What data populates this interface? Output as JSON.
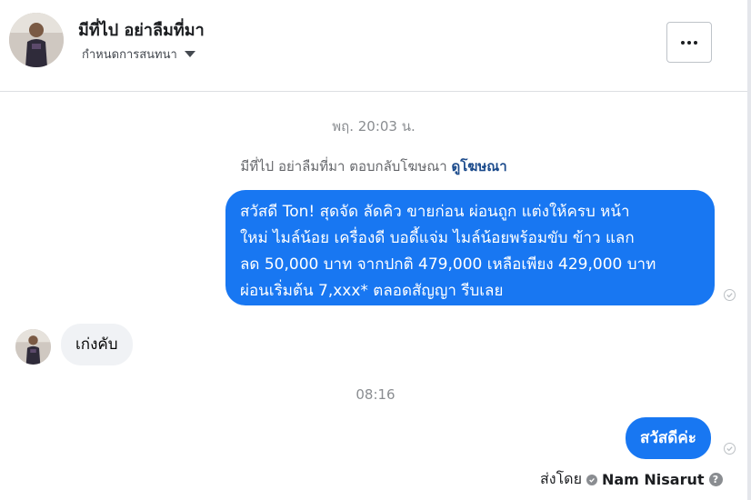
{
  "header": {
    "title": "มีที่ไป อย่าลืมที่มา",
    "subtitle": "กำหนดการสนทนา",
    "more_label": "..."
  },
  "messages": {
    "timestamp_1": "พฤ. 20:03 น.",
    "notice_text": "มีที่ไป อย่าลืมที่มา ตอบกลับโฆษณา",
    "notice_link": "ดูโฆษณา",
    "outgoing_1_lines": [
      "สวัสดี Ton!  สุดจัด ลัดคิว ขายก่อน ผ่อนถูก แต่งให้ครบ หน้า",
      "ใหม่ ไมล์น้อย เครื่องดี บอดี้แจ่ม ไมล์น้อยพร้อมขับ ข้าว แลก",
      "ลด 50,000 บาท จากปกติ 479,000 เหลือเพียง 429,000 บาท",
      "ผ่อนเริ่มต้น 7,xxx* ตลอดสัญญา รีบเลย"
    ],
    "incoming_1": "เก่งคับ",
    "timestamp_2": "08:16",
    "outgoing_2": "สวัสดีค่ะ"
  },
  "footer": {
    "sent_by_label": "ส่งโดย",
    "sender_name": "Nam Nisarut",
    "help_icon": "?"
  },
  "colors": {
    "bubble_out": "#1877f2",
    "bubble_in": "#f0f2f5",
    "link": "#1c4b8c"
  },
  "icons": [
    "more-icon",
    "caret-down-icon",
    "seen-check-icon",
    "verified-icon",
    "help-icon"
  ]
}
